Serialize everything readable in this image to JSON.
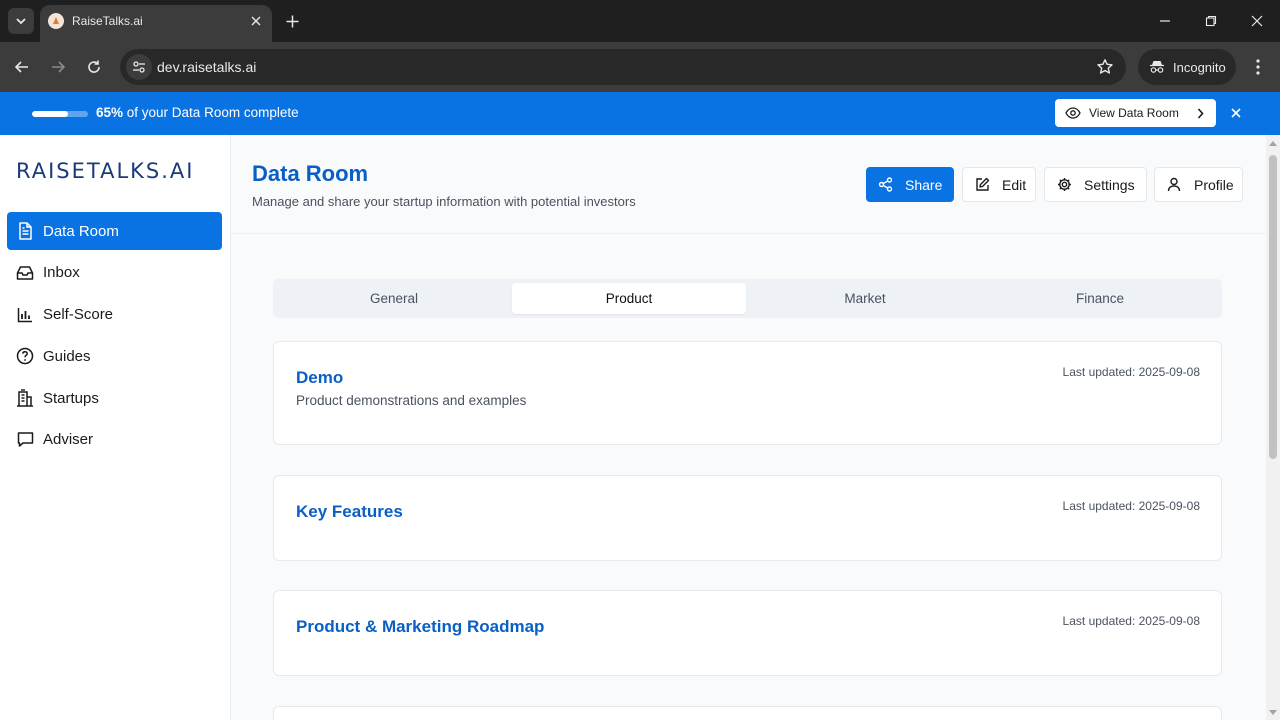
{
  "browser": {
    "tab_title": "RaiseTalks.ai",
    "url": "dev.raisetalks.ai",
    "incognito_label": "Incognito"
  },
  "banner": {
    "percent_text": "65%",
    "message": " of your Data Room complete",
    "progress": 0.65,
    "view_button": "View Data Room"
  },
  "sidebar": {
    "logo": "RAISETALKS.AI",
    "items": [
      {
        "label": "Data Room",
        "icon": "document-icon",
        "active": true
      },
      {
        "label": "Inbox",
        "icon": "inbox-icon"
      },
      {
        "label": "Self-Score",
        "icon": "bar-chart-icon"
      },
      {
        "label": "Guides",
        "icon": "help-circle-icon"
      },
      {
        "label": "Startups",
        "icon": "building-icon"
      },
      {
        "label": "Adviser",
        "icon": "message-icon"
      }
    ]
  },
  "header": {
    "title": "Data Room",
    "subtitle": "Manage and share your startup information with potential investors",
    "share": "Share",
    "edit": "Edit",
    "settings": "Settings",
    "profile": "Profile"
  },
  "tabs": [
    "General",
    "Product",
    "Market",
    "Finance"
  ],
  "active_tab": "Product",
  "cards": [
    {
      "title": "Demo",
      "description": "Product demonstrations and examples",
      "updated": "Last updated: 2025-09-08"
    },
    {
      "title": "Key Features",
      "description": "",
      "updated": "Last updated: 2025-09-08"
    },
    {
      "title": "Product & Marketing Roadmap",
      "description": "",
      "updated": "Last updated: 2025-09-08"
    }
  ],
  "colors": {
    "accent": "#0a73e3",
    "title_blue": "#0a5fc4",
    "chrome_dark": "#1f1f1f",
    "chrome_toolbar": "#3c3c3c"
  }
}
